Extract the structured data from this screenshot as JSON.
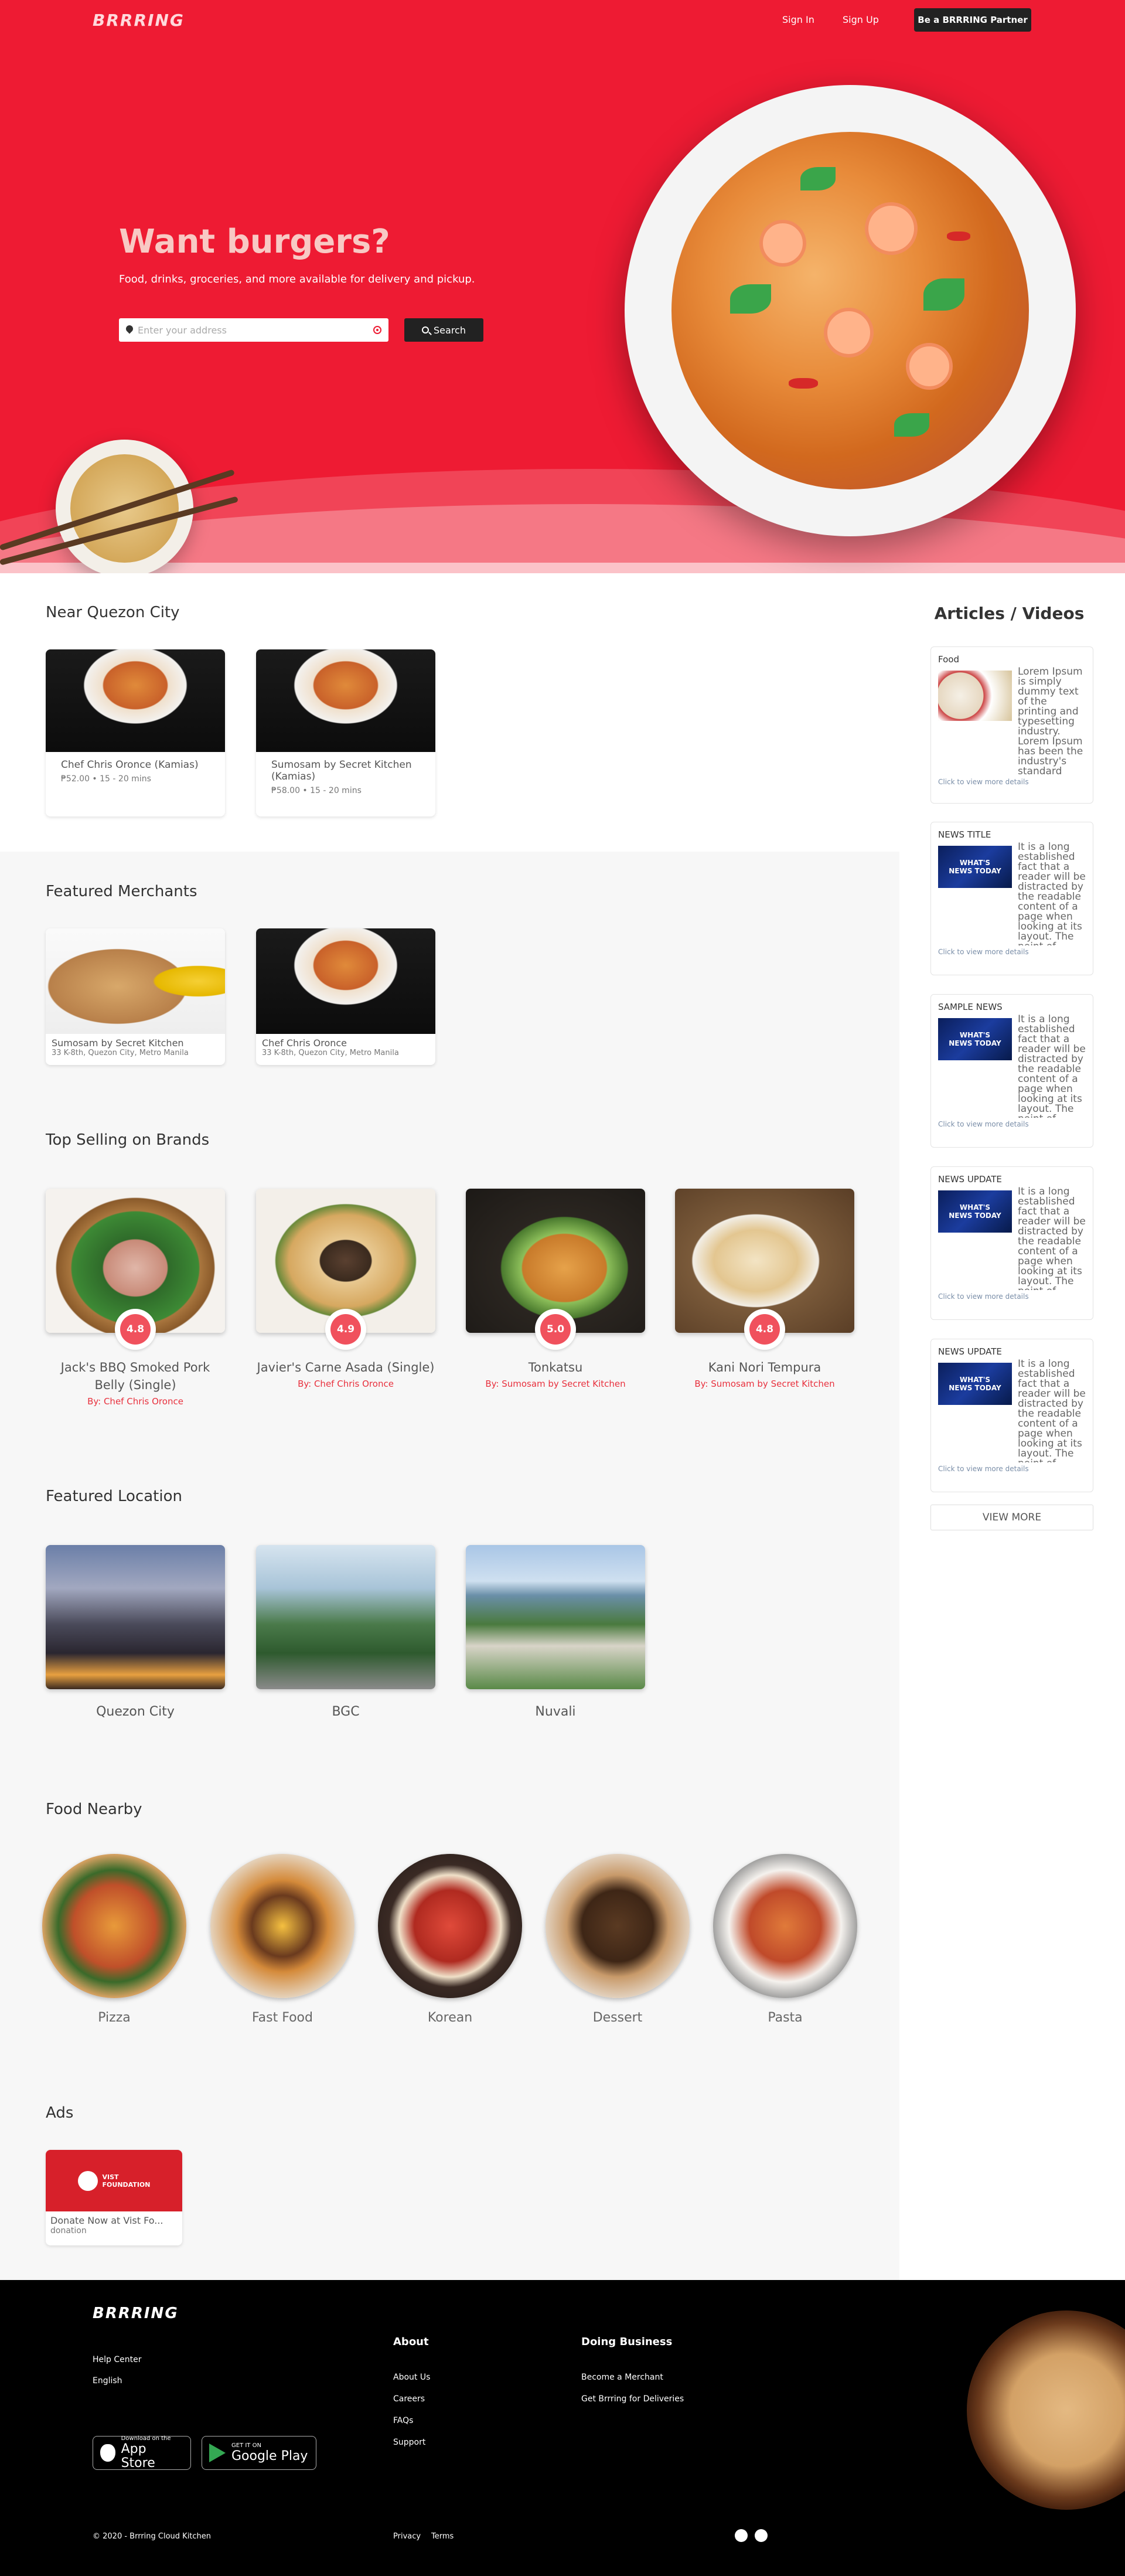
{
  "brand": {
    "logo": "BRRRING"
  },
  "nav": {
    "sign_in": "Sign In",
    "sign_up": "Sign Up",
    "partner": "Be a BRRRING Partner"
  },
  "hero": {
    "title": "Want burgers?",
    "subtitle": "Food, drinks, groceries, and more available for delivery and pickup.",
    "address_placeholder": "Enter your address",
    "search_label": "Search"
  },
  "near": {
    "title": "Near Quezon City",
    "items": [
      {
        "name": "Chef Chris Oronce (Kamias)",
        "meta": "₱52.00 • 15 - 20 mins"
      },
      {
        "name": "Sumosam by Secret Kitchen (Kamias)",
        "meta": "₱58.00 • 15 - 20 mins"
      }
    ]
  },
  "featured_merchants": {
    "title": "Featured Merchants",
    "items": [
      {
        "name": "Sumosam by Secret Kitchen",
        "address": "33 K-8th, Quezon City, Metro Manila"
      },
      {
        "name": "Chef Chris Oronce",
        "address": "33 K-8th, Quezon City, Metro Manila"
      }
    ]
  },
  "top_selling": {
    "title": "Top Selling on Brands",
    "items": [
      {
        "name": "Jack's BBQ Smoked Pork Belly (Single)",
        "rating": "4.8",
        "by": "By: Chef Chris Oronce"
      },
      {
        "name": "Javier's Carne Asada (Single)",
        "rating": "4.9",
        "by": "By: Chef Chris Oronce"
      },
      {
        "name": "Tonkatsu",
        "rating": "5.0",
        "by": "By: Sumosam by Secret Kitchen"
      },
      {
        "name": "Kani Nori Tempura",
        "rating": "4.8",
        "by": "By: Sumosam by Secret Kitchen"
      }
    ]
  },
  "featured_location": {
    "title": "Featured Location",
    "items": [
      {
        "name": "Quezon City"
      },
      {
        "name": "BGC"
      },
      {
        "name": "Nuvali"
      }
    ]
  },
  "food_nearby": {
    "title": "Food Nearby",
    "items": [
      {
        "name": "Pizza"
      },
      {
        "name": "Fast Food"
      },
      {
        "name": "Korean"
      },
      {
        "name": "Dessert"
      },
      {
        "name": "Pasta"
      }
    ]
  },
  "ads": {
    "title": "Ads",
    "items": [
      {
        "name": "Donate Now at Vist Fo...",
        "type": "donation",
        "brand_line1": "VIST",
        "brand_line2": "FOUNDATION"
      }
    ]
  },
  "articles": {
    "title": "Articles / Videos",
    "link_label": "Click to view more details",
    "view_more": "VIEW MORE",
    "items": [
      {
        "category": "Food",
        "text": "Lorem Ipsum is simply dummy text of the printing and typesetting industry. Lorem Ipsum has been the industry's standard dummy text ever since the 1500s, when an unknown printer took a galley of type"
      },
      {
        "category": "NEWS TITLE",
        "text": "It is a long established fact that a reader will be distracted by the readable content of a page when looking at its layout. The point of using Lorem Ipsum is that it has a more-or-less normal distribution of letters"
      },
      {
        "category": "SAMPLE NEWS",
        "text": "It is a long established fact that a reader will be distracted by the readable content of a page when looking at its layout. The point of using Lorem Ipsum is that it has a more-or-less normal distribution of letters"
      },
      {
        "category": "NEWS UPDATE",
        "text": "It is a long established fact that a reader will be distracted by the readable content of a page when looking at its layout. The point of using Lorem Ipsum is that it has a more-or-less normal distribution of letters"
      },
      {
        "category": "NEWS UPDATE",
        "text": "It is a long established fact that a reader will be distracted by the readable content of a page when looking at its layout. The point of using Lorem Ipsum is that it has a more-or-less normal distribution of letters"
      }
    ]
  },
  "footer": {
    "logo": "BRRRING",
    "help_center": "Help Center",
    "language": "English",
    "about": {
      "title": "About",
      "links": [
        "About Us",
        "Careers",
        "FAQs",
        "Support"
      ]
    },
    "doing_business": {
      "title": "Doing Business",
      "links": [
        "Become a Merchant",
        "Get Brrring for Deliveries"
      ]
    },
    "app_store": {
      "small": "Download on the",
      "big": "App Store"
    },
    "google_play": {
      "small": "GET IT ON",
      "big": "Google Play"
    },
    "copyright": "© 2020 - Brrring Cloud Kitchen",
    "privacy": "Privacy",
    "terms": "Terms"
  },
  "colors": {
    "brand_red": "#ee1b33",
    "dark": "#222222",
    "rating_red": "#f0515d",
    "footer_bg": "#000000"
  }
}
